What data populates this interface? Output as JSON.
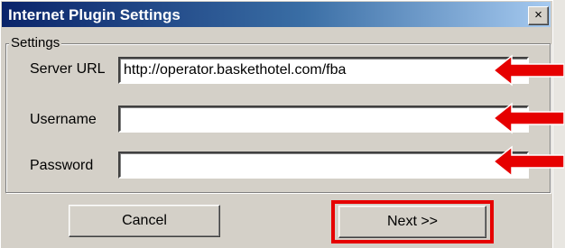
{
  "window": {
    "title": "Internet Plugin Settings",
    "close_glyph": "×"
  },
  "settings_group": {
    "label": "Settings",
    "fields": [
      {
        "label": "Server URL",
        "value": "http://operator.baskethotel.com/fba",
        "placeholder": ""
      },
      {
        "label": "Username",
        "value": "",
        "placeholder": ""
      },
      {
        "label": "Password",
        "value": "",
        "placeholder": ""
      }
    ]
  },
  "buttons": {
    "cancel_label": "Cancel",
    "next_label": "Next >>"
  },
  "annotations": {
    "arrow_color": "#e60000",
    "highlight_color": "#e60000",
    "arrow_icon": "red-arrow-left-icon"
  },
  "colors": {
    "dialog_bg": "#d4d0c8",
    "title_gradient_start": "#0a246a",
    "title_gradient_end": "#a6caf0"
  }
}
